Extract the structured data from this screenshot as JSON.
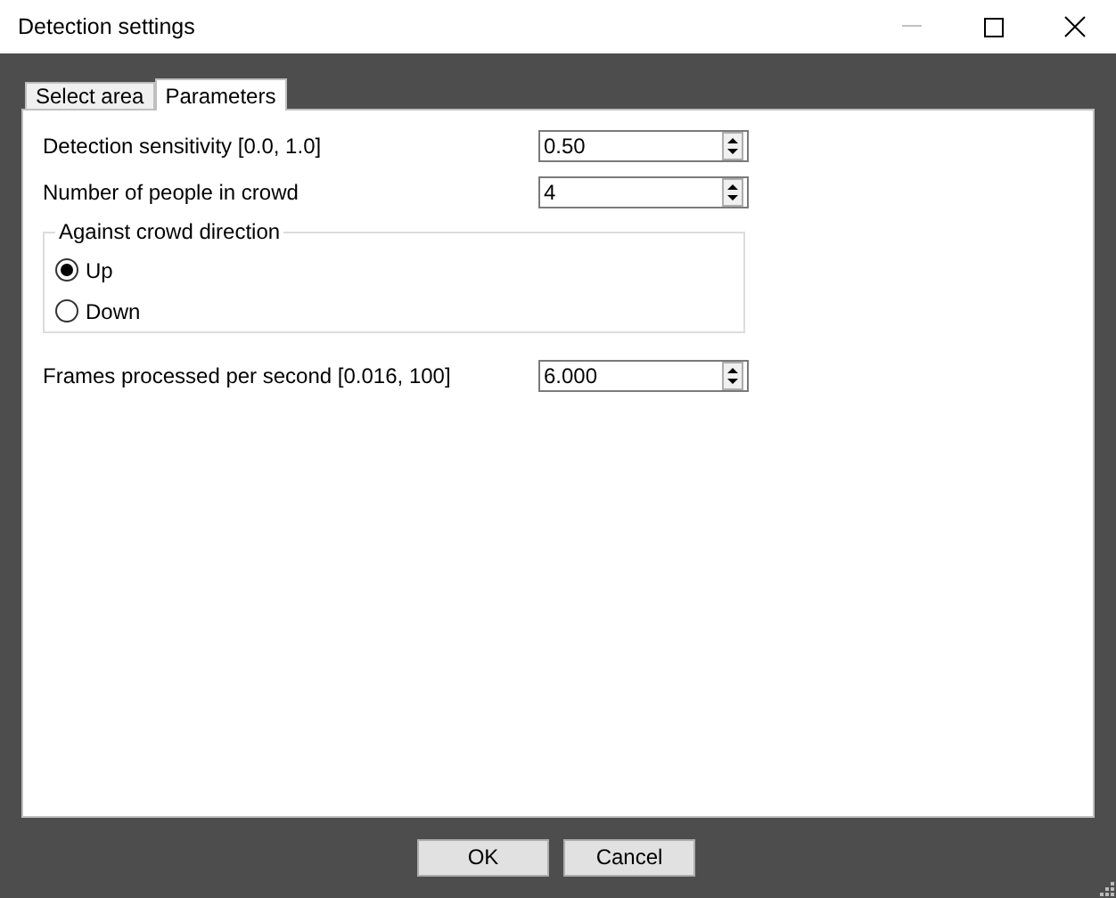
{
  "window": {
    "title": "Detection settings"
  },
  "tabs": [
    {
      "label": "Select area",
      "selected": false
    },
    {
      "label": "Parameters",
      "selected": true
    }
  ],
  "fields": [
    {
      "label": "Detection sensitivity [0.0, 1.0]",
      "value": "0.50"
    },
    {
      "label": "Number of people in crowd",
      "value": "4"
    }
  ],
  "direction_group": {
    "title": "Against crowd direction",
    "options": [
      {
        "label": "Up",
        "selected": true
      },
      {
        "label": "Down",
        "selected": false
      }
    ]
  },
  "frames_field": {
    "label": "Frames processed per second [0.016, 100]",
    "value": "6.000"
  },
  "buttons": [
    "OK",
    "Cancel"
  ]
}
